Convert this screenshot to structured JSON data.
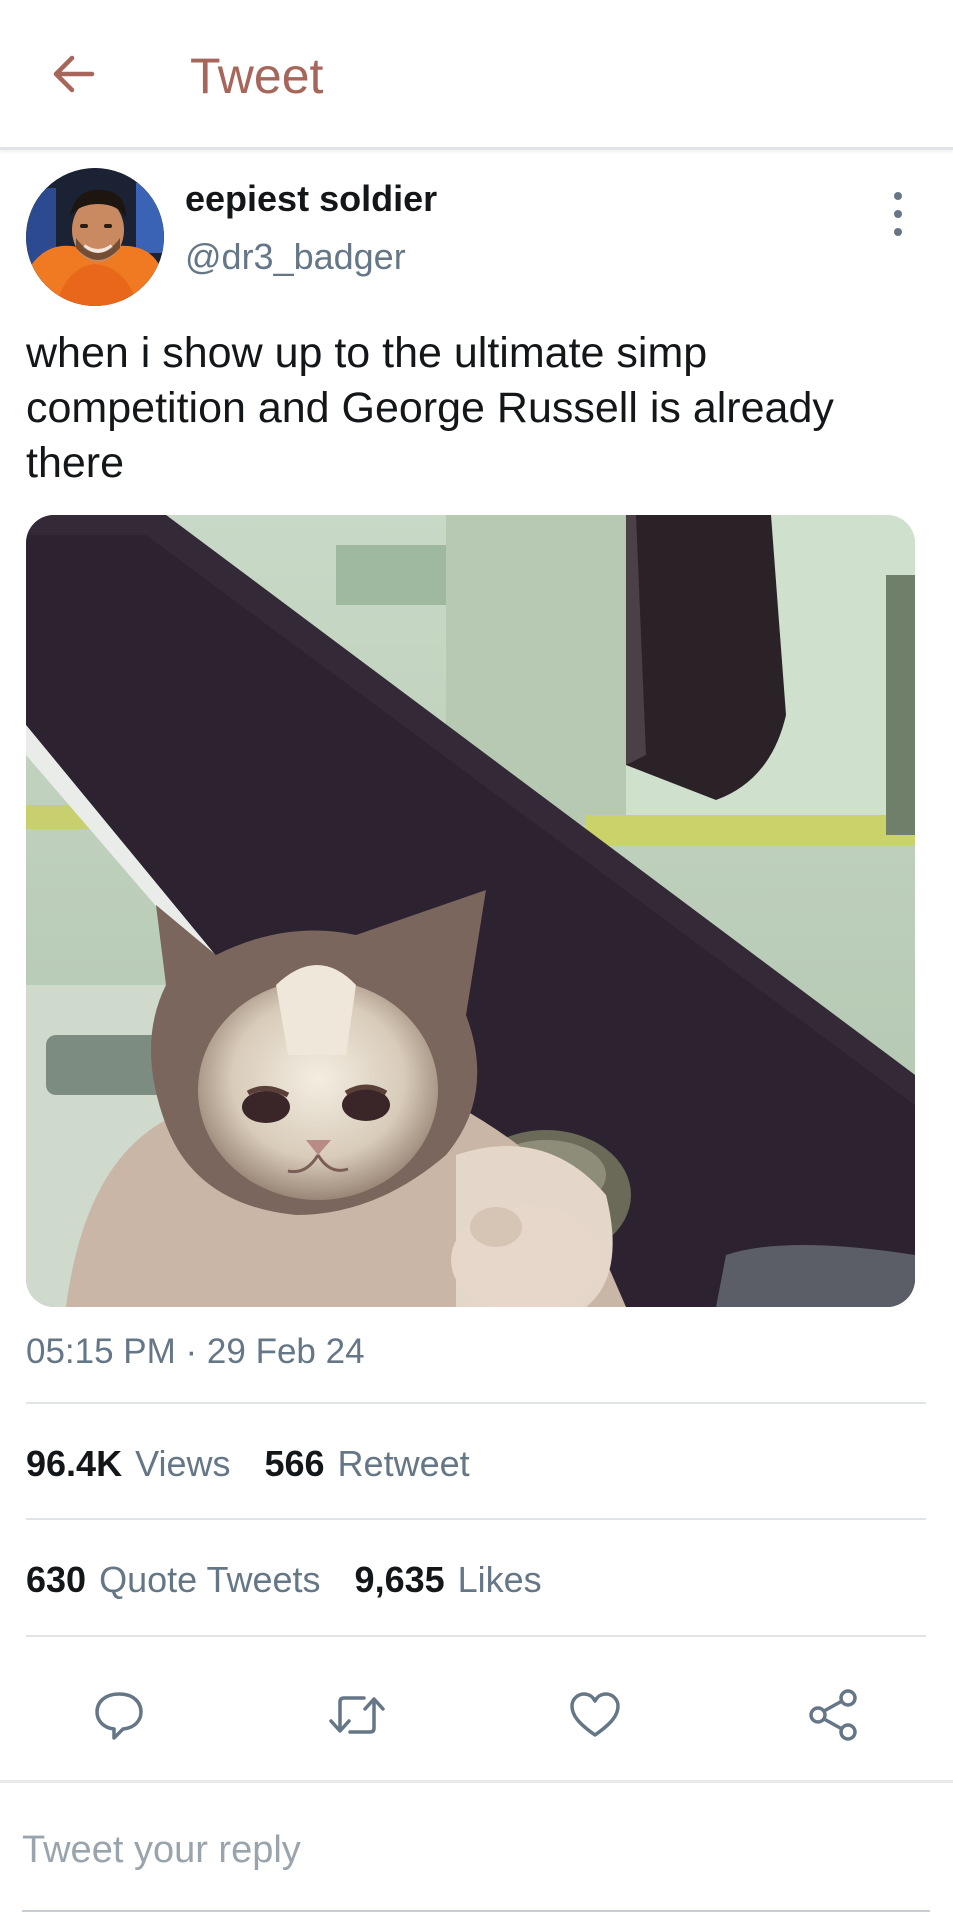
{
  "header": {
    "title": "Tweet",
    "back_icon": "arrow-left-icon",
    "accent_color": "#a6665a"
  },
  "tweet": {
    "author": {
      "display_name": "eepiest soldier",
      "handle": "@dr3_badger",
      "avatar": "profile-photo"
    },
    "text": "when i show up to the ultimate simp competition and George Russell is already there",
    "media": "photo of a cat peeking through a car window",
    "timestamp": "05:15 PM · 29 Feb 24",
    "stats": {
      "views_count": "96.4K",
      "views_label": "Views",
      "retweet_count": "566",
      "retweet_label": "Retweet",
      "quote_count": "630",
      "quote_label": "Quote Tweets",
      "likes_count": "9,635",
      "likes_label": "Likes"
    },
    "actions": [
      "reply-icon",
      "retweet-icon",
      "like-icon",
      "share-icon"
    ]
  },
  "reply": {
    "placeholder": "Tweet your reply",
    "value": ""
  },
  "colors": {
    "text_primary": "#14171a",
    "text_secondary": "#657786",
    "divider": "#e1e4e6"
  }
}
